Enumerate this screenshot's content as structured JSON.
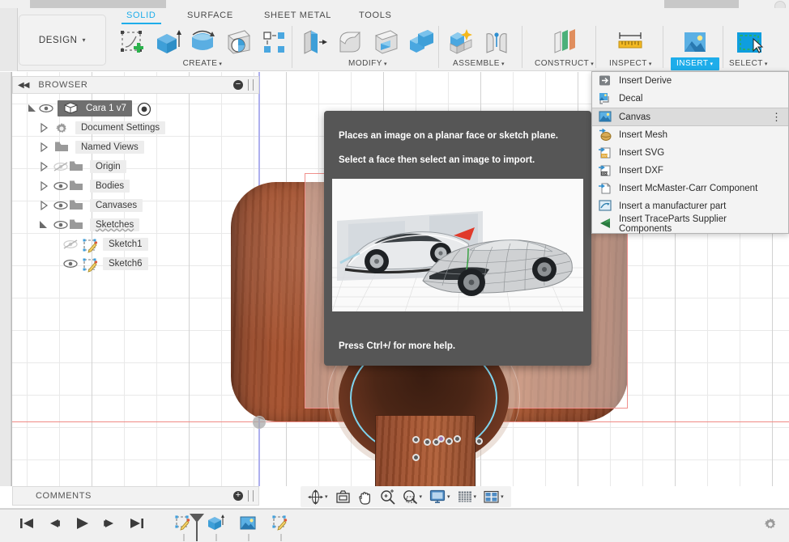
{
  "app": {
    "workspace_label": "DESIGN",
    "workspace_caret": "▾"
  },
  "tabs": [
    {
      "label": "SOLID",
      "active": true
    },
    {
      "label": "SURFACE",
      "active": false
    },
    {
      "label": "SHEET METAL",
      "active": false
    },
    {
      "label": "TOOLS",
      "active": false
    }
  ],
  "ribbon_groups": [
    {
      "label": "CREATE",
      "caret": "▾",
      "icons": [
        "create-sketch-icon",
        "extrude-icon",
        "revolve-icon",
        "sweep-icon",
        "pattern-icon"
      ]
    },
    {
      "label": "MODIFY",
      "caret": "▾",
      "icons": [
        "press-pull-icon",
        "fillet-icon",
        "shell-icon",
        "combine-icon"
      ]
    },
    {
      "label": "ASSEMBLE",
      "caret": "▾",
      "icons": [
        "new-component-icon",
        "joint-icon"
      ]
    },
    {
      "label": "CONSTRUCT",
      "caret": "▾",
      "icons": [
        "offset-plane-icon"
      ]
    },
    {
      "label": "INSPECT",
      "caret": "▾",
      "icons": [
        "measure-icon"
      ]
    },
    {
      "label": "INSERT",
      "caret": "▾",
      "icons": [
        "insert-image-icon"
      ],
      "highlighted": true
    },
    {
      "label": "SELECT",
      "caret": "▾",
      "icons": [
        "select-window-icon"
      ]
    }
  ],
  "insert_menu": {
    "items": [
      {
        "label": "Insert Derive",
        "icon": "insert-derive-icon",
        "highlighted": false,
        "has_overflow": false
      },
      {
        "label": "Decal",
        "icon": "decal-icon",
        "highlighted": false,
        "has_overflow": false
      },
      {
        "label": "Canvas",
        "icon": "canvas-icon",
        "highlighted": true,
        "has_overflow": true
      },
      {
        "label": "Insert Mesh",
        "icon": "insert-mesh-icon",
        "highlighted": false,
        "has_overflow": false
      },
      {
        "label": "Insert SVG",
        "icon": "insert-svg-icon",
        "highlighted": false,
        "has_overflow": false
      },
      {
        "label": "Insert DXF",
        "icon": "insert-dxf-icon",
        "highlighted": false,
        "has_overflow": false
      },
      {
        "label": "Insert McMaster-Carr Component",
        "icon": "insert-mcmaster-icon",
        "highlighted": false,
        "has_overflow": false
      },
      {
        "label": "Insert a manufacturer part",
        "icon": "insert-manufacturer-icon",
        "highlighted": false,
        "has_overflow": false
      },
      {
        "label": "Insert TraceParts Supplier Components",
        "icon": "insert-traceparts-icon",
        "highlighted": false,
        "has_overflow": false
      }
    ],
    "overflow_glyph": "⋮"
  },
  "tooltip": {
    "line1": "Places an image on a planar face or sketch plane.",
    "line2": "Select a face then select an image to import.",
    "footer": "Press Ctrl+/ for more help.",
    "image_alt": "canvas-example-car-sketch"
  },
  "browser": {
    "title": "BROWSER",
    "collapse_glyph": "◀◀",
    "minus_glyph": "−",
    "tree": [
      {
        "label": "Cara 1 v7",
        "indent": 0,
        "expander": "open",
        "visibility": "visible",
        "icon": "component-icon",
        "selected": true,
        "has_activate": true
      },
      {
        "label": "Document Settings",
        "indent": 1,
        "expander": "closed",
        "visibility": "none",
        "icon": "gear-icon",
        "selected": false,
        "has_activate": false
      },
      {
        "label": "Named Views",
        "indent": 1,
        "expander": "closed",
        "visibility": "none",
        "icon": "folder-icon",
        "selected": false,
        "has_activate": false
      },
      {
        "label": "Origin",
        "indent": 1,
        "expander": "closed",
        "visibility": "hidden",
        "icon": "folder-icon",
        "selected": false,
        "has_activate": false
      },
      {
        "label": "Bodies",
        "indent": 1,
        "expander": "closed",
        "visibility": "visible",
        "icon": "folder-icon",
        "selected": false,
        "has_activate": false
      },
      {
        "label": "Canvases",
        "indent": 1,
        "expander": "closed",
        "visibility": "visible",
        "icon": "folder-icon",
        "selected": false,
        "has_activate": false
      },
      {
        "label": "Sketches",
        "indent": 1,
        "expander": "open",
        "visibility": "visible",
        "icon": "folder-icon",
        "selected": false,
        "has_activate": false
      },
      {
        "label": "Sketch1",
        "indent": 2,
        "expander": "none",
        "visibility": "hidden",
        "icon": "sketch-icon",
        "selected": false,
        "has_activate": false
      },
      {
        "label": "Sketch6",
        "indent": 2,
        "expander": "none",
        "visibility": "visible",
        "icon": "sketch-icon",
        "selected": false,
        "has_activate": false
      }
    ]
  },
  "comments": {
    "title": "COMMENTS",
    "plus_glyph": "+"
  },
  "navbar": {
    "buttons": [
      {
        "name": "orbit-icon",
        "caret": "▾"
      },
      {
        "name": "look-at-icon",
        "caret": ""
      },
      {
        "name": "pan-icon",
        "caret": ""
      },
      {
        "name": "zoom-icon",
        "caret": ""
      },
      {
        "name": "zoom-window-icon",
        "caret": "▾"
      },
      {
        "name": "display-settings-icon",
        "caret": "▾"
      },
      {
        "name": "grid-snaps-icon",
        "caret": "▾"
      },
      {
        "name": "viewports-icon",
        "caret": "▾"
      }
    ]
  },
  "timeline": {
    "controls": [
      "go-to-beginning-icon",
      "step-back-icon",
      "play-icon",
      "step-forward-icon",
      "go-to-end-icon"
    ],
    "features": [
      "sketch-feature-icon",
      "extrude-feature-icon",
      "canvas-feature-icon",
      "sketch-feature-icon"
    ],
    "playhead": "timeline-marker-icon",
    "settings": "gear-icon"
  },
  "colors": {
    "accent_blue": "#1eadea",
    "panel_bg": "#f0f0f0",
    "tooltip_bg": "#565656",
    "body_wood": "#a8532f",
    "axis_x": "#f08a84",
    "axis_y": "#aeb0ee",
    "sketch_outline": "#f0908c",
    "sketch_curve": "#7fd4ee"
  }
}
